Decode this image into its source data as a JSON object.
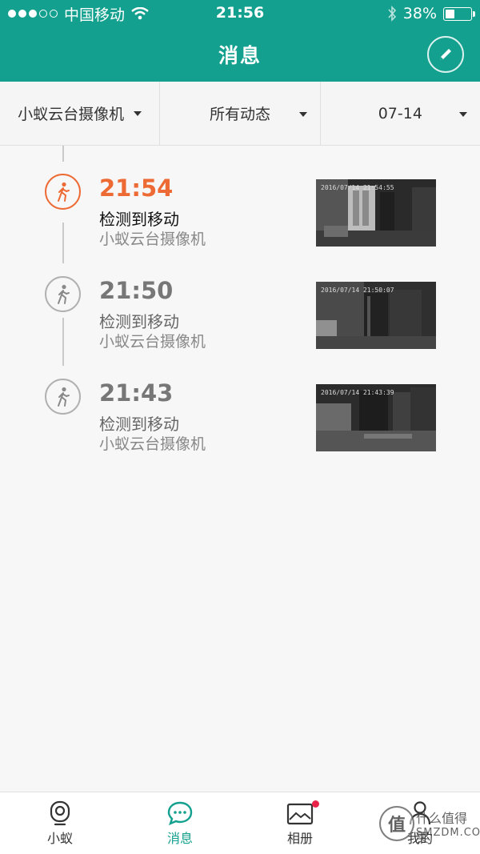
{
  "status_bar": {
    "carrier": "中国移动",
    "time": "21:56",
    "battery": "38%",
    "battery_level": 0.38,
    "icons": [
      "signal-dots-icon",
      "wifi-icon",
      "bluetooth-icon",
      "battery-icon"
    ]
  },
  "header": {
    "title": "消息",
    "edit_icon": "pencil-icon"
  },
  "filters": {
    "device": "小蚁云台摄像机",
    "type": "所有动态",
    "date": "07-14"
  },
  "events": [
    {
      "time": "21:54",
      "type": "检测到移动",
      "device": "小蚁云台摄像机",
      "thumb_stamp": "2016/07/14 21:54:55",
      "active": true,
      "icon": "walking-person-icon"
    },
    {
      "time": "21:50",
      "type": "检测到移动",
      "device": "小蚁云台摄像机",
      "thumb_stamp": "2016/07/14 21:50:07",
      "active": false,
      "icon": "walking-person-icon"
    },
    {
      "time": "21:43",
      "type": "检测到移动",
      "device": "小蚁云台摄像机",
      "thumb_stamp": "2016/07/14 21:43:39",
      "active": false,
      "icon": "walking-person-icon"
    }
  ],
  "tabbar": {
    "tabs": [
      {
        "label": "小蚁",
        "icon": "camera-icon",
        "active": false
      },
      {
        "label": "消息",
        "icon": "message-bubble-icon",
        "active": true
      },
      {
        "label": "相册",
        "icon": "album-icon",
        "active": false,
        "badge": true
      },
      {
        "label": "我的",
        "icon": "profile-icon",
        "active": false
      }
    ]
  },
  "watermark": {
    "glyph": "值",
    "text": "什么值得买",
    "sub": "SMZDM.COM"
  },
  "colors": {
    "brand": "#13a08e",
    "accent": "#ee6a34",
    "badge": "#e8234a"
  }
}
